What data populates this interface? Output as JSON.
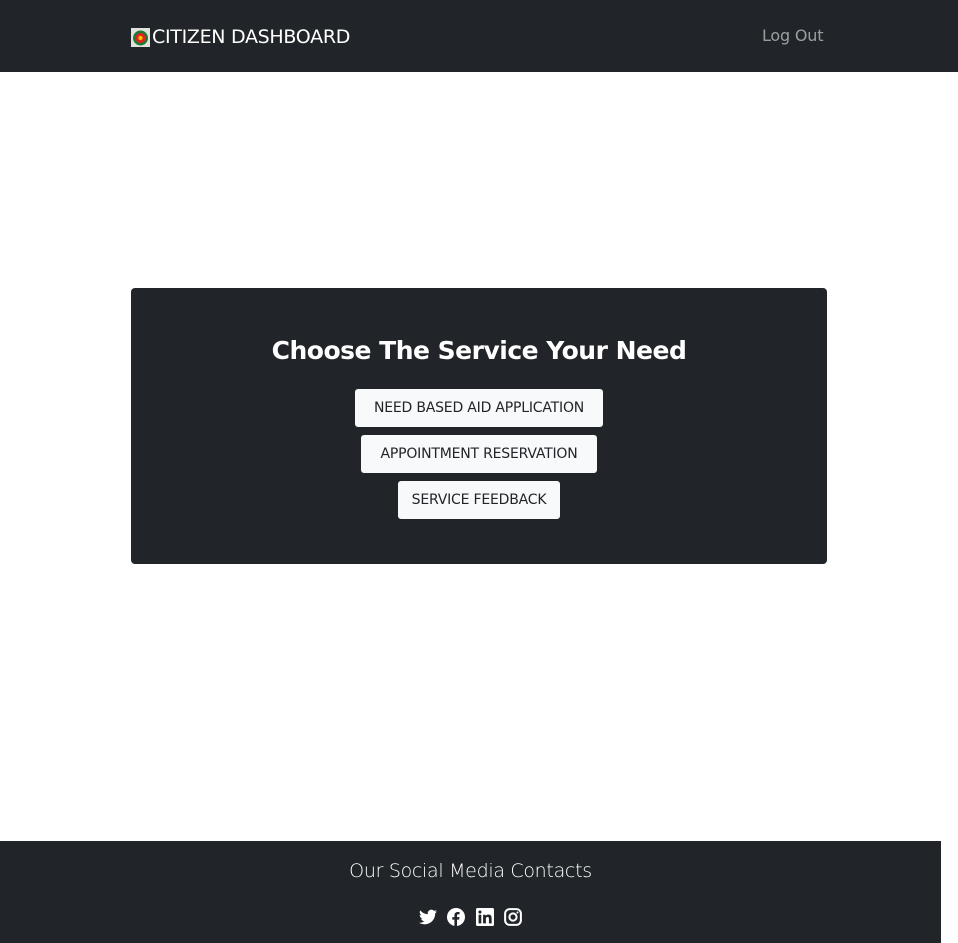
{
  "navbar": {
    "brand_text": "CITIZEN DASHBOARD",
    "logout_label": "Log Out"
  },
  "main": {
    "heading": "Choose The Service Your Need",
    "buttons": [
      {
        "label": "NEED BASED AID APPLICATION"
      },
      {
        "label": "APPOINTMENT RESERVATION"
      },
      {
        "label": "SERVICE FEEDBACK"
      }
    ]
  },
  "footer": {
    "title": "Our Social Media Contacts",
    "icons": [
      "twitter-icon",
      "facebook-icon",
      "linkedin-icon",
      "instagram-icon"
    ]
  },
  "colors": {
    "dark": "#212529",
    "light": "#f8f9fa",
    "muted_link": "#9a9da0",
    "logo_green": "#1f7a3a",
    "logo_red": "#e0241c"
  }
}
